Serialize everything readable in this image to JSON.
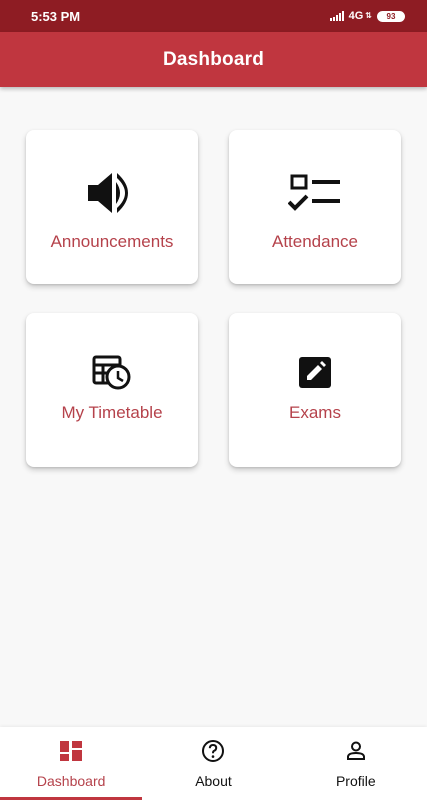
{
  "status_bar": {
    "time": "5:53 PM",
    "network": "4G",
    "battery": "93"
  },
  "app_bar": {
    "title": "Dashboard"
  },
  "dashboard": {
    "cards": [
      {
        "label": "Announcements",
        "icon": "volume-up-icon"
      },
      {
        "label": "Attendance",
        "icon": "checklist-icon"
      },
      {
        "label": "My Timetable",
        "icon": "schedule-icon"
      },
      {
        "label": "Exams",
        "icon": "edit-icon"
      }
    ]
  },
  "bottom_nav": {
    "items": [
      {
        "label": "Dashboard",
        "icon": "dashboard-icon",
        "active": true
      },
      {
        "label": "About",
        "icon": "help-circle-icon",
        "active": false
      },
      {
        "label": "Profile",
        "icon": "person-icon",
        "active": false
      }
    ]
  },
  "colors": {
    "status_bar": "#8e1c23",
    "app_bar": "#c0363f",
    "accent_text": "#b5424b",
    "background": "#f8f8f8"
  }
}
